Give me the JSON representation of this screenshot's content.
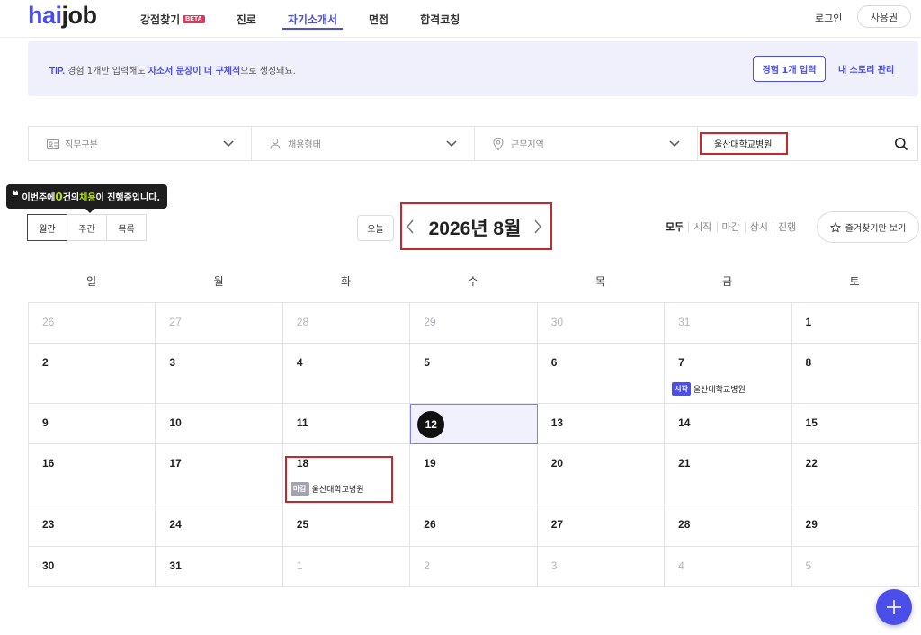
{
  "header": {
    "logo_hai": "hai",
    "logo_job": "job",
    "nav": [
      {
        "label": "강점찾기",
        "badge": "BETA"
      },
      {
        "label": "진로"
      },
      {
        "label": "자기소개서",
        "active": true
      },
      {
        "label": "면접"
      },
      {
        "label": "합격코칭"
      }
    ],
    "login": "로그인",
    "usage_button": "사용권"
  },
  "tip": {
    "label": "TIP.",
    "text_1": " 경험 1개만 입력해도 ",
    "highlight": "자소서 문장이 더 구체적",
    "text_2": "으로 생성돼요.",
    "button": "경험 1개 입력",
    "link": "내 스토리 관리"
  },
  "filters": {
    "job_type": "직무구분",
    "employment_type": "채용형태",
    "location": "근무지역",
    "search_value": "울산대학교병원"
  },
  "tooltip": {
    "prefix": "이번주에 ",
    "count": "0",
    "middle": "건의 ",
    "highlight": "채용",
    "suffix": "이 진행중입니다."
  },
  "view_tabs": [
    "월간",
    "주간",
    "목록"
  ],
  "today_button": "오늘",
  "month_title": "2026년 8월",
  "status_filters": [
    "모두",
    "시작",
    "마감",
    "상시",
    "진행"
  ],
  "favorites_button": "즐겨찾기만 보기",
  "weekdays": [
    "일",
    "월",
    "화",
    "수",
    "목",
    "금",
    "토"
  ],
  "weeks": [
    [
      {
        "d": "26",
        "m": true
      },
      {
        "d": "27",
        "m": true
      },
      {
        "d": "28",
        "m": true
      },
      {
        "d": "29",
        "m": true
      },
      {
        "d": "30",
        "m": true
      },
      {
        "d": "31",
        "m": true
      },
      {
        "d": "1"
      }
    ],
    [
      {
        "d": "2"
      },
      {
        "d": "3"
      },
      {
        "d": "4"
      },
      {
        "d": "5"
      },
      {
        "d": "6"
      },
      {
        "d": "7",
        "event": {
          "badge": "시작",
          "type": "start",
          "name": "울산대학교병원"
        }
      },
      {
        "d": "8"
      }
    ],
    [
      {
        "d": "9"
      },
      {
        "d": "10"
      },
      {
        "d": "11"
      },
      {
        "d": "12",
        "today": true
      },
      {
        "d": "13"
      },
      {
        "d": "14"
      },
      {
        "d": "15"
      }
    ],
    [
      {
        "d": "16"
      },
      {
        "d": "17"
      },
      {
        "d": "18",
        "event": {
          "badge": "마감",
          "type": "end",
          "name": "울산대학교병원"
        },
        "highlight": true
      },
      {
        "d": "19"
      },
      {
        "d": "20"
      },
      {
        "d": "21"
      },
      {
        "d": "22"
      }
    ],
    [
      {
        "d": "23"
      },
      {
        "d": "24"
      },
      {
        "d": "25"
      },
      {
        "d": "26"
      },
      {
        "d": "27"
      },
      {
        "d": "28"
      },
      {
        "d": "29"
      }
    ],
    [
      {
        "d": "30"
      },
      {
        "d": "31"
      },
      {
        "d": "1",
        "m": true
      },
      {
        "d": "2",
        "m": true
      },
      {
        "d": "3",
        "m": true
      },
      {
        "d": "4",
        "m": true
      },
      {
        "d": "5",
        "m": true
      }
    ]
  ],
  "colors": {
    "accent": "#4b4ee8",
    "annotation_red": "#c6262c",
    "tooltip_green": "#b3e000"
  }
}
